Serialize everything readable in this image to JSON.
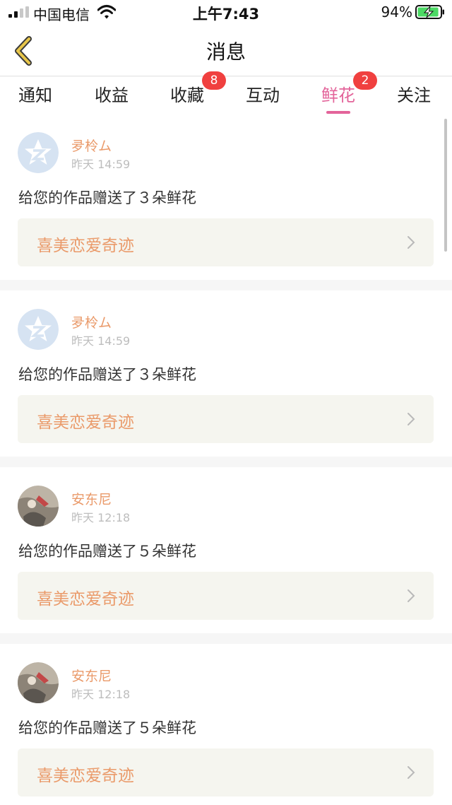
{
  "status_bar": {
    "carrier": "中国电信",
    "time": "上午7:43",
    "battery": "94%",
    "battery_level": 0.94
  },
  "header": {
    "title": "消息"
  },
  "tabs": [
    {
      "label": "通知",
      "badge": null,
      "active": false
    },
    {
      "label": "收益",
      "badge": null,
      "active": false
    },
    {
      "label": "收藏",
      "badge": "8",
      "active": false
    },
    {
      "label": "互动",
      "badge": null,
      "active": false
    },
    {
      "label": "鲜花",
      "badge": "2",
      "active": true
    },
    {
      "label": "关注",
      "badge": null,
      "active": false
    }
  ],
  "messages": [
    {
      "username": "夛柃ム",
      "time": "昨天 14:59",
      "text": "给您的作品赠送了３朵鲜花",
      "work_title": "喜美恋爱奇迹",
      "avatar": "qq-default-avatar"
    },
    {
      "username": "夛柃ム",
      "time": "昨天 14:59",
      "text": "给您的作品赠送了３朵鲜花",
      "work_title": "喜美恋爱奇迹",
      "avatar": "qq-default-avatar"
    },
    {
      "username": "安东尼",
      "time": "昨天 12:18",
      "text": "给您的作品赠送了５朵鲜花",
      "work_title": "喜美恋爱奇迹",
      "avatar": "photo-avatar"
    },
    {
      "username": "安东尼",
      "time": "昨天 12:18",
      "text": "给您的作品赠送了５朵鲜花",
      "work_title": "喜美恋爱奇迹",
      "avatar": "photo-avatar"
    }
  ],
  "colors": {
    "accent": "#e3649a",
    "username": "#ea9a6a",
    "badge": "#f0403f",
    "link_background": "#f5f5ef",
    "back_arrow": "#e8c64a"
  }
}
